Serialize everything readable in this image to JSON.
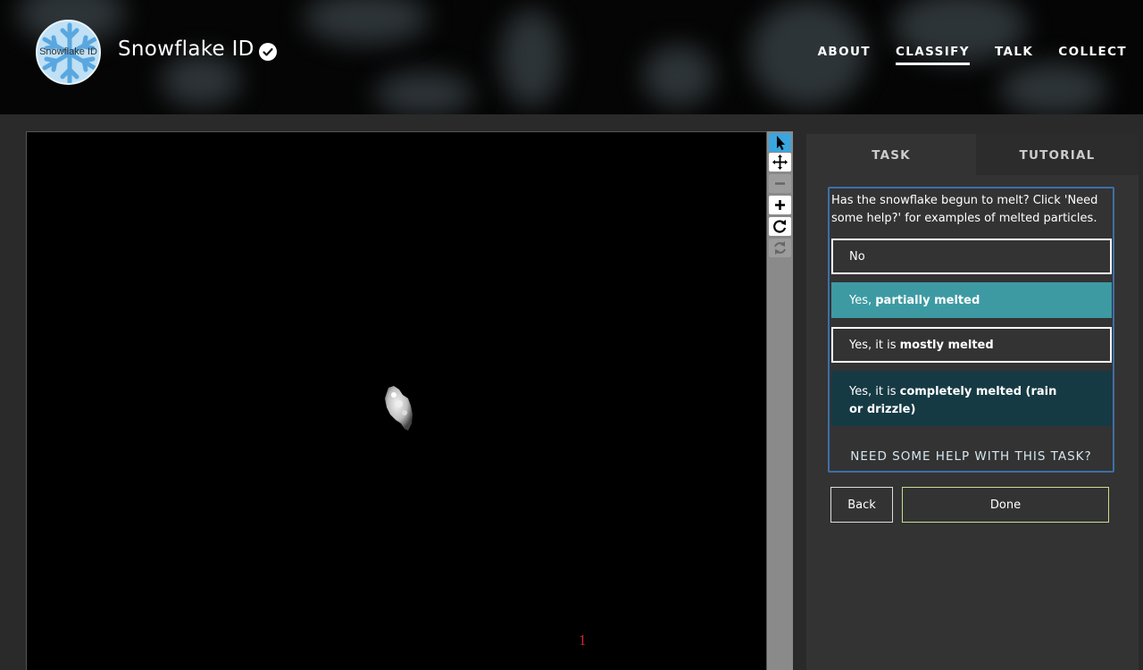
{
  "header": {
    "logo_text": "Snowflake ID",
    "title": "Snowflake ID",
    "nav": [
      {
        "label": "ABOUT",
        "active": false
      },
      {
        "label": "CLASSIFY",
        "active": true
      },
      {
        "label": "TALK",
        "active": false
      },
      {
        "label": "COLLECT",
        "active": false
      }
    ]
  },
  "viewer": {
    "frame_number": "1",
    "tools": [
      "pointer-icon",
      "move-icon",
      "zoom-out-icon",
      "zoom-in-icon",
      "rotate-icon",
      "reset-icon"
    ]
  },
  "panel": {
    "tabs": {
      "task": "TASK",
      "tutorial": "TUTORIAL"
    },
    "question": "Has the snowflake begun to melt? Click 'Need some help?' for examples of melted particles.",
    "answers": {
      "no": {
        "prefix": "No",
        "bold": ""
      },
      "partial": {
        "prefix": "Yes, ",
        "bold": "partially melted"
      },
      "mostly": {
        "prefix": "Yes, it is ",
        "bold": "mostly melted"
      },
      "completely": {
        "prefix": "Yes, it is ",
        "bold": "completely melted (rain or drizzle)"
      }
    },
    "help_label": "NEED SOME HELP WITH THIS TASK?",
    "back_label": "Back",
    "done_label": "Done"
  },
  "colors": {
    "selected_answer": "#3d9aa3",
    "completely_answer": "#163a44",
    "task_border": "#3e6ea8",
    "active_tool": "#3aa5df",
    "done_border": "#c6e08e",
    "frame_number": "#d42a2a"
  }
}
